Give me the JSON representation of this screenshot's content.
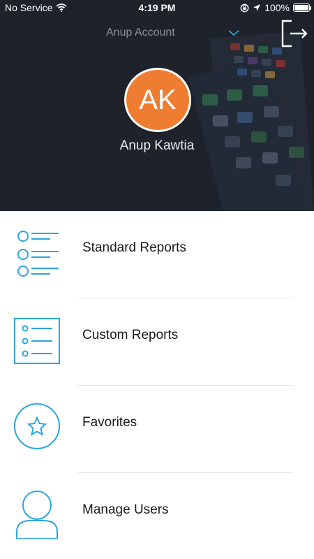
{
  "status_bar": {
    "carrier": "No Service",
    "time": "4:19 PM",
    "battery": "100%",
    "battery_level": 1.0
  },
  "header": {
    "account_name": "Anup Account",
    "avatar_initials": "AK",
    "user_name": "Anup Kawtia"
  },
  "icons": {
    "wifi": "wifi-icon",
    "location": "location-arrow-icon",
    "lock_rotation": "rotation-lock-icon",
    "chevron": "chevron-down-icon",
    "logout": "logout-icon"
  },
  "menu": {
    "items": [
      {
        "label": "Standard Reports",
        "icon": "list-icon"
      },
      {
        "label": "Custom Reports",
        "icon": "document-list-icon"
      },
      {
        "label": "Favorites",
        "icon": "star-icon"
      },
      {
        "label": "Manage Users",
        "icon": "user-icon"
      }
    ]
  },
  "colors": {
    "header_bg": "#1e232b",
    "accent": "#2aa6e0",
    "avatar": "#ee7d31"
  }
}
